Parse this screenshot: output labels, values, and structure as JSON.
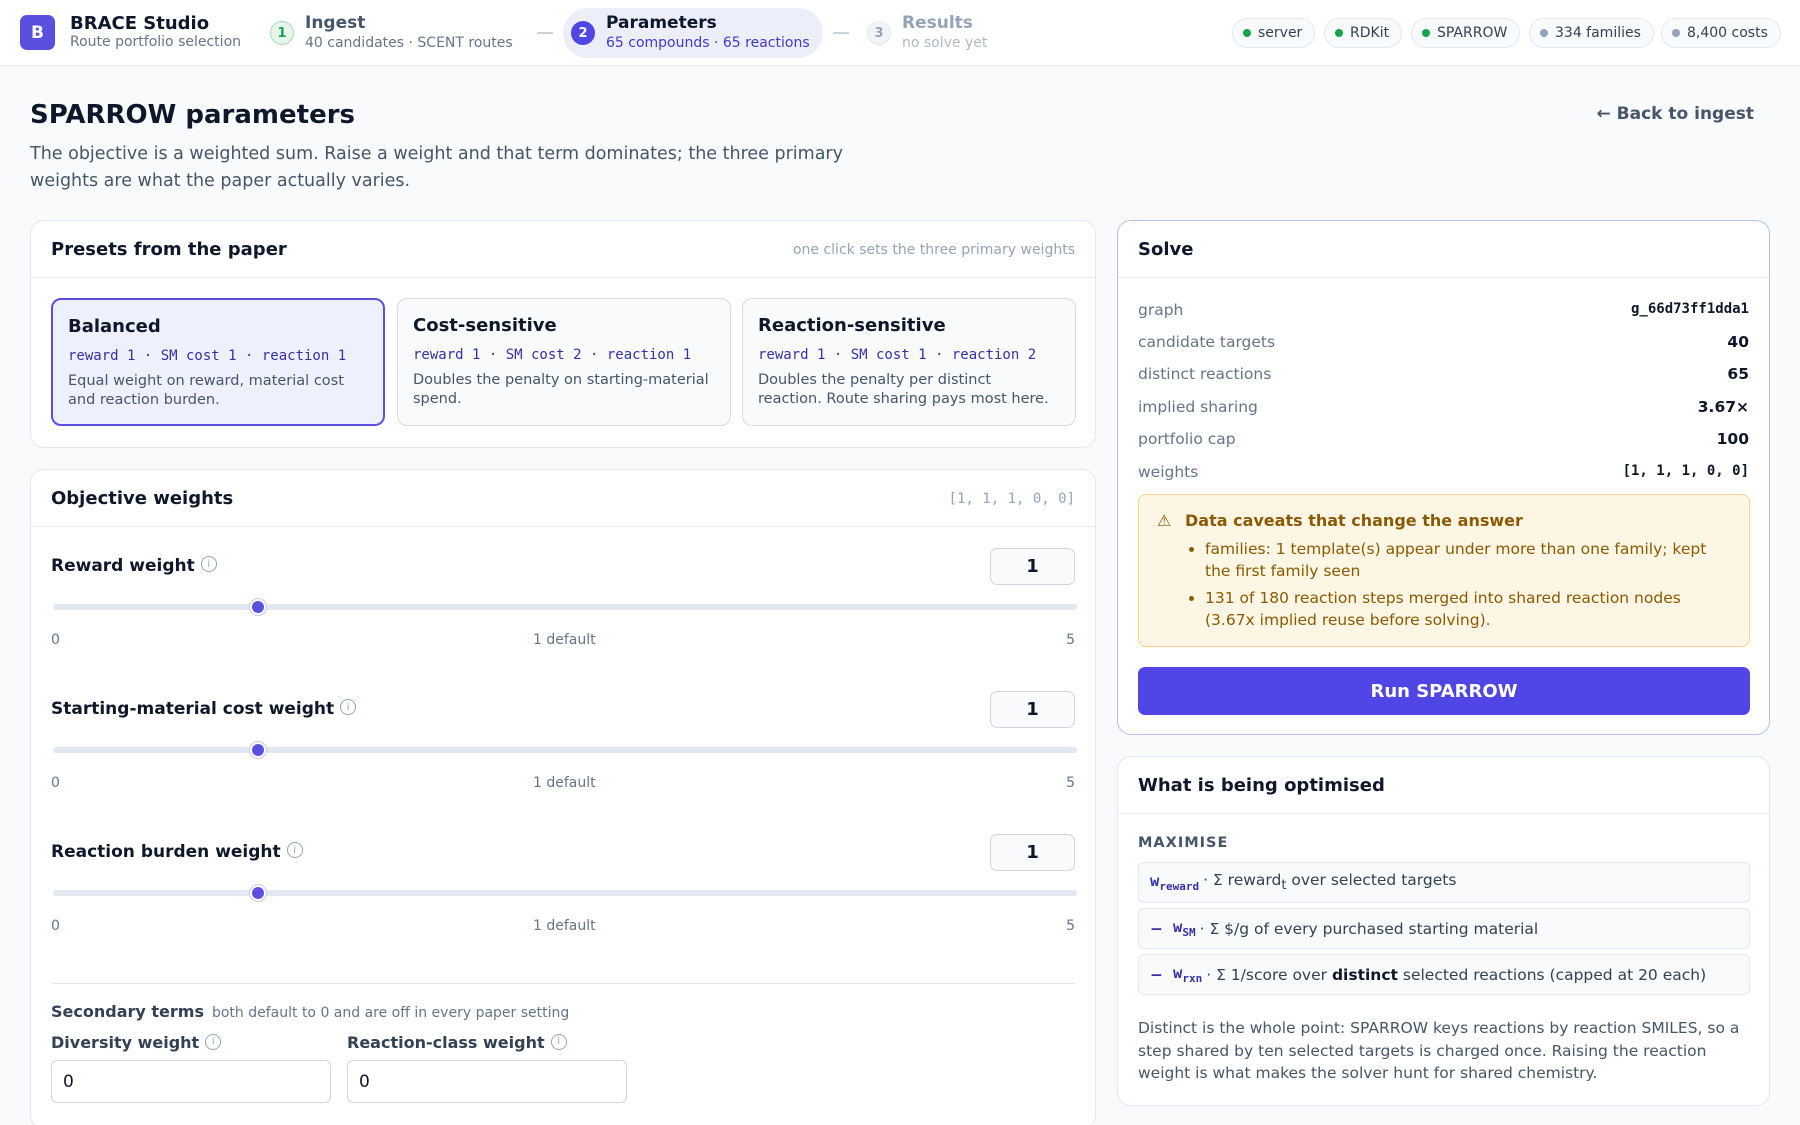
{
  "app": {
    "logo_letter": "B",
    "title": "BRACE Studio",
    "subtitle": "Route portfolio selection"
  },
  "steps": [
    {
      "num": "1",
      "title": "Ingest",
      "subtitle": "40 candidates · SCENT routes",
      "state": "done"
    },
    {
      "num": "2",
      "title": "Parameters",
      "subtitle": "65 compounds · 65 reactions",
      "state": "active"
    },
    {
      "num": "3",
      "title": "Results",
      "subtitle": "no solve yet",
      "state": "pending"
    }
  ],
  "status_chips": [
    {
      "label": "server",
      "color": "#16a34a"
    },
    {
      "label": "RDKit",
      "color": "#16a34a"
    },
    {
      "label": "SPARROW",
      "color": "#16a34a"
    },
    {
      "label": "334 families",
      "color": "#94a3b8"
    },
    {
      "label": "8,400 costs",
      "color": "#94a3b8"
    }
  ],
  "page": {
    "title": "SPARROW parameters",
    "description": "The objective is a weighted sum. Raise a weight and that term dominates; the three primary weights are what the paper actually varies.",
    "back_label": "← Back to ingest"
  },
  "presets": {
    "title": "Presets from the paper",
    "note": "one click sets the three primary weights",
    "items": [
      {
        "title": "Balanced",
        "weights": "reward 1 · SM cost 1 · reaction 1",
        "description": "Equal weight on reward, material cost and reaction burden.",
        "selected": true
      },
      {
        "title": "Cost-sensitive",
        "weights": "reward 1 · SM cost 2 · reaction 1",
        "description": "Doubles the penalty on starting-material spend.",
        "selected": false
      },
      {
        "title": "Reaction-sensitive",
        "weights": "reward 1 · SM cost 1 · reaction 2",
        "description": "Doubles the penalty per distinct reaction. Route sharing pays most here.",
        "selected": false
      }
    ]
  },
  "weights": {
    "title": "Objective weights",
    "vector": "[1, 1, 1, 0, 0]",
    "sliders": [
      {
        "label": "Reward weight",
        "value": "1",
        "fraction": 0.2,
        "min": "0",
        "mid": "1 default",
        "max": "5"
      },
      {
        "label": "Starting-material cost weight",
        "value": "1",
        "fraction": 0.2,
        "min": "0",
        "mid": "1 default",
        "max": "5"
      },
      {
        "label": "Reaction burden weight",
        "value": "1",
        "fraction": 0.2,
        "min": "0",
        "mid": "1 default",
        "max": "5"
      }
    ],
    "secondary": {
      "label": "Secondary terms",
      "hint": "both default to 0 and are off in every paper setting",
      "diversity_label": "Diversity weight",
      "diversity_value": "0",
      "reaction_class_label": "Reaction-class weight",
      "reaction_class_value": "0"
    },
    "info_glyph": "i"
  },
  "solve": {
    "title": "Solve",
    "rows": [
      {
        "key": "graph",
        "value": "g_66d73ff1dda1"
      },
      {
        "key": "candidate targets",
        "value": "40"
      },
      {
        "key": "distinct reactions",
        "value": "65"
      },
      {
        "key": "implied sharing",
        "value": "3.67×"
      },
      {
        "key": "portfolio cap",
        "value": "100"
      },
      {
        "key": "weights",
        "value": "[1, 1, 1, 0, 0]"
      }
    ],
    "caveat": {
      "icon": "⚠",
      "title": "Data caveats that change the answer",
      "items": [
        "families: 1 template(s) appear under more than one family; kept the first family seen",
        "131 of 180 reaction steps merged into shared reaction nodes (3.67x implied reuse before solving)."
      ]
    },
    "run_label": "Run SPARROW"
  },
  "optimised": {
    "title": "What is being optimised",
    "maximise_label": "MAXIMISE",
    "terms": [
      {
        "prefix": "",
        "symbol": "w",
        "sub": "reward",
        "text_a": " · Σ reward",
        "text_sub": "t",
        "text_b": " over selected targets",
        "bold": "",
        "text_c": ""
      },
      {
        "prefix": "−",
        "symbol": "w",
        "sub": "SM",
        "text_a": " · Σ $/g of every purchased starting material",
        "text_sub": "",
        "text_b": "",
        "bold": "",
        "text_c": ""
      },
      {
        "prefix": "−",
        "symbol": "w",
        "sub": "rxn",
        "text_a": " · Σ 1/score over ",
        "text_sub": "",
        "text_b": "",
        "bold": "distinct",
        "text_c": " selected reactions (capped at 20 each)"
      }
    ],
    "note": "Distinct is the whole point: SPARROW keys reactions by reaction SMILES, so a step shared by ten selected targets is charged once. Raising the reaction weight is what makes the solver hunt for shared chemistry."
  }
}
